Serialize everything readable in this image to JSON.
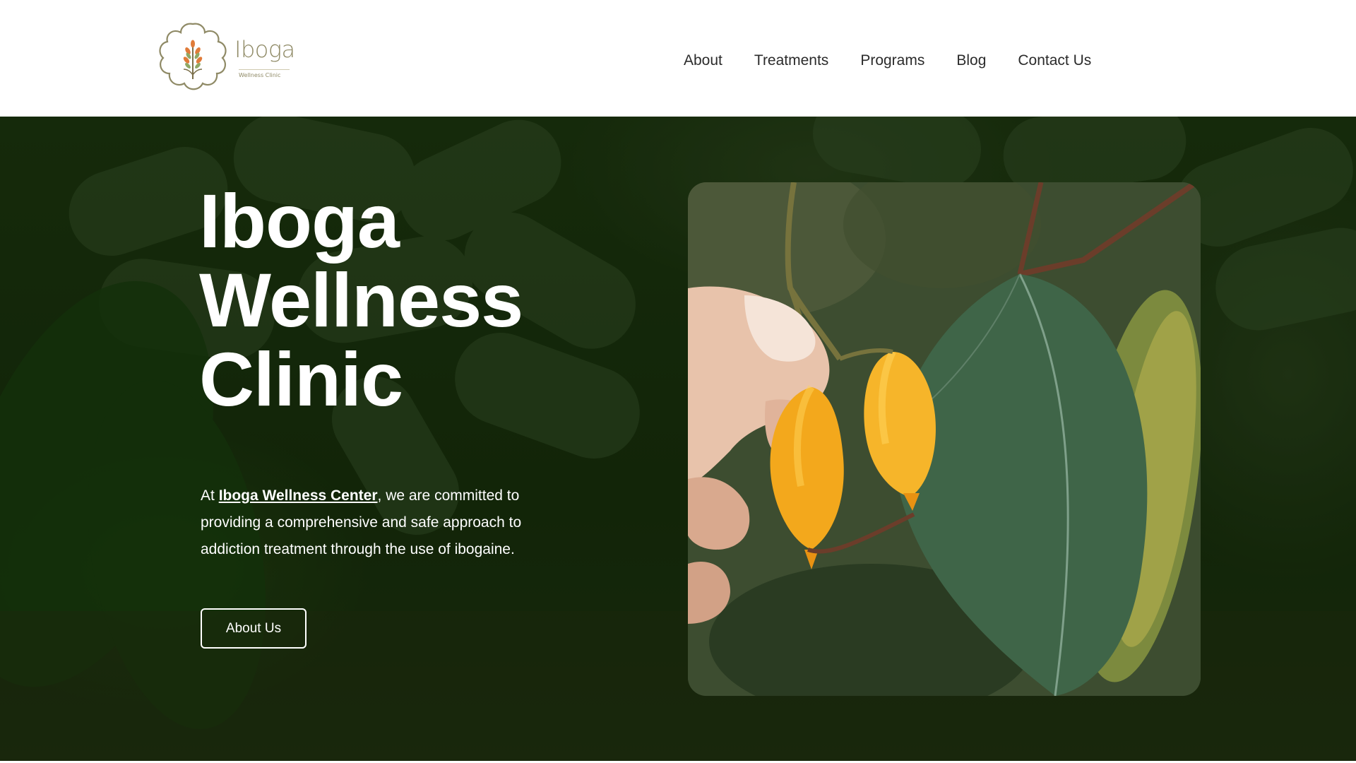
{
  "brand": {
    "name": "Iboga",
    "subtitle": "Wellness Clinic",
    "icon": "iboga-tree-logo-icon"
  },
  "nav": {
    "items": [
      {
        "label": "About"
      },
      {
        "label": "Treatments"
      },
      {
        "label": "Programs"
      },
      {
        "label": "Blog"
      },
      {
        "label": "Contact Us"
      }
    ]
  },
  "hero": {
    "title_lines": [
      "Iboga",
      "Wellness",
      "Clinic"
    ],
    "intro_prefix": "At ",
    "intro_link": "Iboga Wellness Center",
    "intro_suffix": ", we are committed to providing a comprehensive and safe approach to addiction treatment through the use of ibogaine.",
    "cta_label": "About Us",
    "photo": "iboga-fruit-on-plant-photo"
  },
  "colors": {
    "brand_olive": "#8f8a66",
    "hero_green": "#18280c",
    "fruit_orange": "#f3a81c",
    "leaf_green": "#3f6548"
  }
}
